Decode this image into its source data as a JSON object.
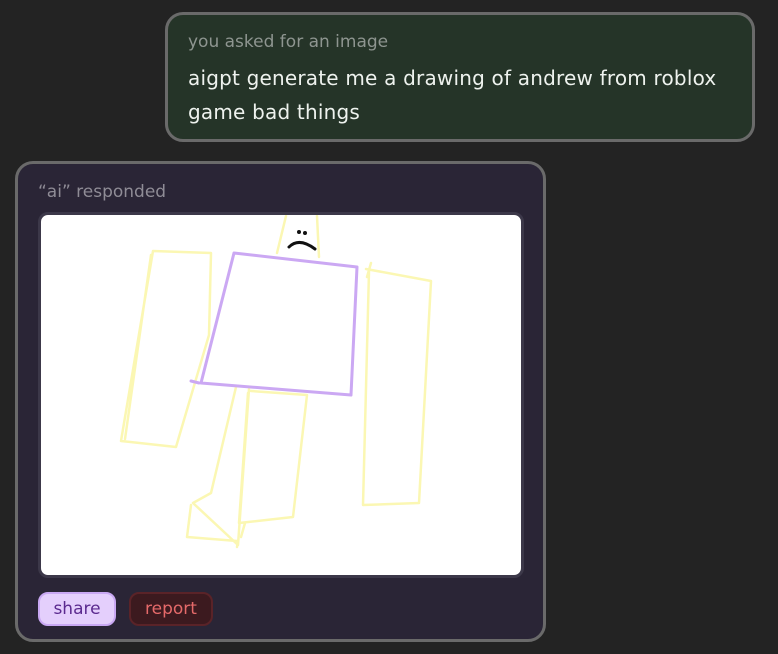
{
  "user_message": {
    "caption": "you asked for an image",
    "text": "aigpt generate me a drawing of andrew from roblox game bad things"
  },
  "ai_response": {
    "caption": "“ai” responded",
    "image": {
      "depicts": "roblox-character-doodle",
      "colors": {
        "body_outline": "#cba8f3",
        "limb_outline": "#fbf7b3",
        "face": "#111111",
        "background": "#ffffff"
      }
    },
    "actions": {
      "share_label": "share",
      "report_label": "report"
    }
  },
  "colors": {
    "page_background": "#232323",
    "user_bubble_bg": "#253428",
    "ai_card_bg": "#2a2536",
    "border": "#6a6a6a"
  }
}
